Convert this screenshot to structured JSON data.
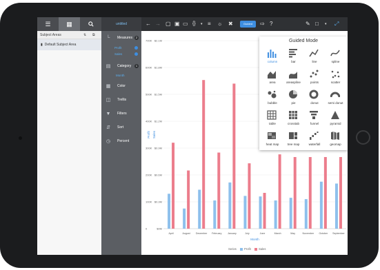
{
  "colors": {
    "profit": "#8ec0ec",
    "sales": "#ec7d8c",
    "accent": "#3e8ee0",
    "toolbar": "#2f3134"
  },
  "left_panel": {
    "tabs": [
      "menu-icon",
      "list-icon",
      "search-icon"
    ],
    "header": "Subject Areas",
    "items": [
      {
        "icon": "document-icon",
        "label": "Default Subject Area"
      }
    ]
  },
  "top_chip": "untitled",
  "toolbar": {
    "icons": [
      "undo-icon",
      "redo-icon",
      "new-file-icon",
      "save-icon",
      "open-folder-icon",
      "braces-icon",
      "chart-settings-icon",
      "style-icon",
      "guided-mode-icon",
      "export-icon",
      "help-icon",
      "edit-icon",
      "layout-icon",
      "expand-icon"
    ],
    "guided_label": "Guided",
    "help": "?"
  },
  "sidebar": {
    "measures": {
      "label": "Measures",
      "count": "2",
      "items": [
        "Profit",
        "Sales"
      ]
    },
    "category": {
      "label": "Category",
      "count": "1",
      "items": [
        "Month"
      ]
    },
    "color": "Color",
    "trellis": "Trellis",
    "filters": "Filters",
    "sort": "Sort",
    "percent": "Percent"
  },
  "guided_mode": {
    "title": "Guided Mode",
    "items": [
      {
        "label": "column",
        "icon": "column-chart-icon",
        "selected": true
      },
      {
        "label": "bar",
        "icon": "bar-chart-icon"
      },
      {
        "label": "line",
        "icon": "line-chart-icon"
      },
      {
        "label": "spline",
        "icon": "spline-chart-icon"
      },
      {
        "label": "area",
        "icon": "area-chart-icon"
      },
      {
        "label": "areaspline",
        "icon": "areaspline-chart-icon"
      },
      {
        "label": "points",
        "icon": "points-chart-icon"
      },
      {
        "label": "scatter",
        "icon": "scatter-chart-icon"
      },
      {
        "label": "bubble",
        "icon": "bubble-chart-icon"
      },
      {
        "label": "pie",
        "icon": "pie-chart-icon"
      },
      {
        "label": "donut",
        "icon": "donut-chart-icon"
      },
      {
        "label": "semi donut",
        "icon": "semi-donut-chart-icon"
      },
      {
        "label": "table",
        "icon": "table-icon"
      },
      {
        "label": "crosstab",
        "icon": "crosstab-icon"
      },
      {
        "label": "funnel",
        "icon": "funnel-chart-icon"
      },
      {
        "label": "pyramid",
        "icon": "pyramid-chart-icon"
      },
      {
        "label": "heat map",
        "icon": "heat-map-icon"
      },
      {
        "label": "tree map",
        "icon": "tree-map-icon"
      },
      {
        "label": "waterfall",
        "icon": "waterfall-chart-icon"
      },
      {
        "label": "geomap",
        "icon": "geomap-icon"
      }
    ]
  },
  "chart_data": {
    "type": "bar",
    "xlabel": "Month",
    "ylabel_left": "Profit",
    "ylabel_right": "Sales",
    "categories": [
      "April",
      "August",
      "December",
      "February",
      "January",
      "July",
      "June",
      "March",
      "May",
      "November",
      "October",
      "September"
    ],
    "y_left_ticks": [
      "0",
      "100K",
      "200K",
      "300K",
      "400K",
      "500K",
      "600K",
      "700K"
    ],
    "y_right_ticks": [
      "$0M",
      "$0.3M",
      "$0.6M",
      "$0.9M",
      "$1.2M",
      "$1.5M",
      "$1.8M",
      "$2.1M"
    ],
    "y_left_range": [
      0,
      700
    ],
    "y_right_range": [
      0,
      2.1
    ],
    "series": [
      {
        "name": "Profit",
        "axis": "left",
        "values": [
          130,
          75,
          145,
          105,
          172,
          122,
          120,
          105,
          115,
          110,
          175,
          168
        ]
      },
      {
        "name": "Sales",
        "axis": "right",
        "values": [
          0.96,
          0.65,
          1.66,
          0.85,
          1.62,
          0.73,
          0.4,
          0.83,
          0.8,
          0.8,
          0.8,
          0.8
        ]
      }
    ],
    "legend_title": "Series",
    "legend_position": "bottom"
  }
}
